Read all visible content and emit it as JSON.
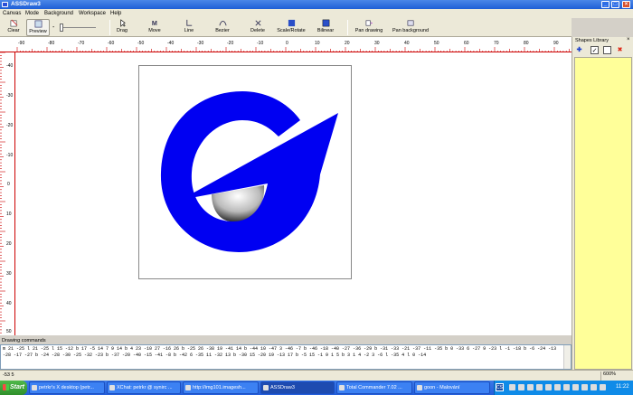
{
  "window": {
    "title": "ASSDraw3"
  },
  "menu": [
    "Canvas",
    "Mode",
    "Background",
    "Workspace",
    "Help"
  ],
  "toolbar": {
    "clear": "Clear",
    "preview": "Preview",
    "drag": "Drag",
    "move": "Move",
    "line": "Line",
    "bezier": "Bezier",
    "delete": "Delete",
    "scale_rotate": "Scale/Rotate",
    "bilinear": "Bilinear",
    "pan_drawing": "Pan drawing",
    "pan_background": "Pan background"
  },
  "ruler": {
    "h": [
      "-90",
      "-80",
      "-70",
      "-60",
      "-50",
      "-40",
      "-30",
      "-20",
      "-10",
      "0",
      "10",
      "20",
      "30",
      "40",
      "50",
      "60",
      "70",
      "80",
      "90"
    ],
    "v": [
      "-40",
      "-30",
      "-20",
      "-10",
      "0",
      "10",
      "20",
      "30",
      "40",
      "50"
    ]
  },
  "shapes_library": {
    "title": "Shapes Library"
  },
  "commands": {
    "label": "Drawing commands",
    "text": "m 21 -25 l 21 -25 l 15 -12 b 17 -5 14 7 9 14 b 4 23 -10 27 -16 26 b -25 26 -38 19 -41 14 b -44 10 -47 3 -46 -7 b -46 -18 -40 -27 -36 -29 b -31 -33 -21 -37 -11 -35 b 0 -33 6 -27 9 -23 l -1 -18 b -6 -24 -13 -28 -17 -27 b -24 -28 -30 -25 -32 -23 b -37 -20 -40 -15 -41 -8 b -42 6 -35 11 -32 13 b -30 15 -20 19 -13 17 b -5 15 -1 9 1 5 b 3 1 4 -2 3 -6 l -35 4 l 0 -14"
  },
  "status": {
    "coords": "-53    5",
    "zoom": "600%"
  },
  "taskbar": {
    "start": "Start",
    "tasks": [
      "petrkr's X desktop (petr...",
      "XChat: petrkr @ synirc ...",
      "http://img101.imagesh...",
      "ASSDraw3",
      "Total Commander 7.02 ...",
      "goon - Malování"
    ],
    "lang": "CS",
    "clock": "11:22"
  }
}
